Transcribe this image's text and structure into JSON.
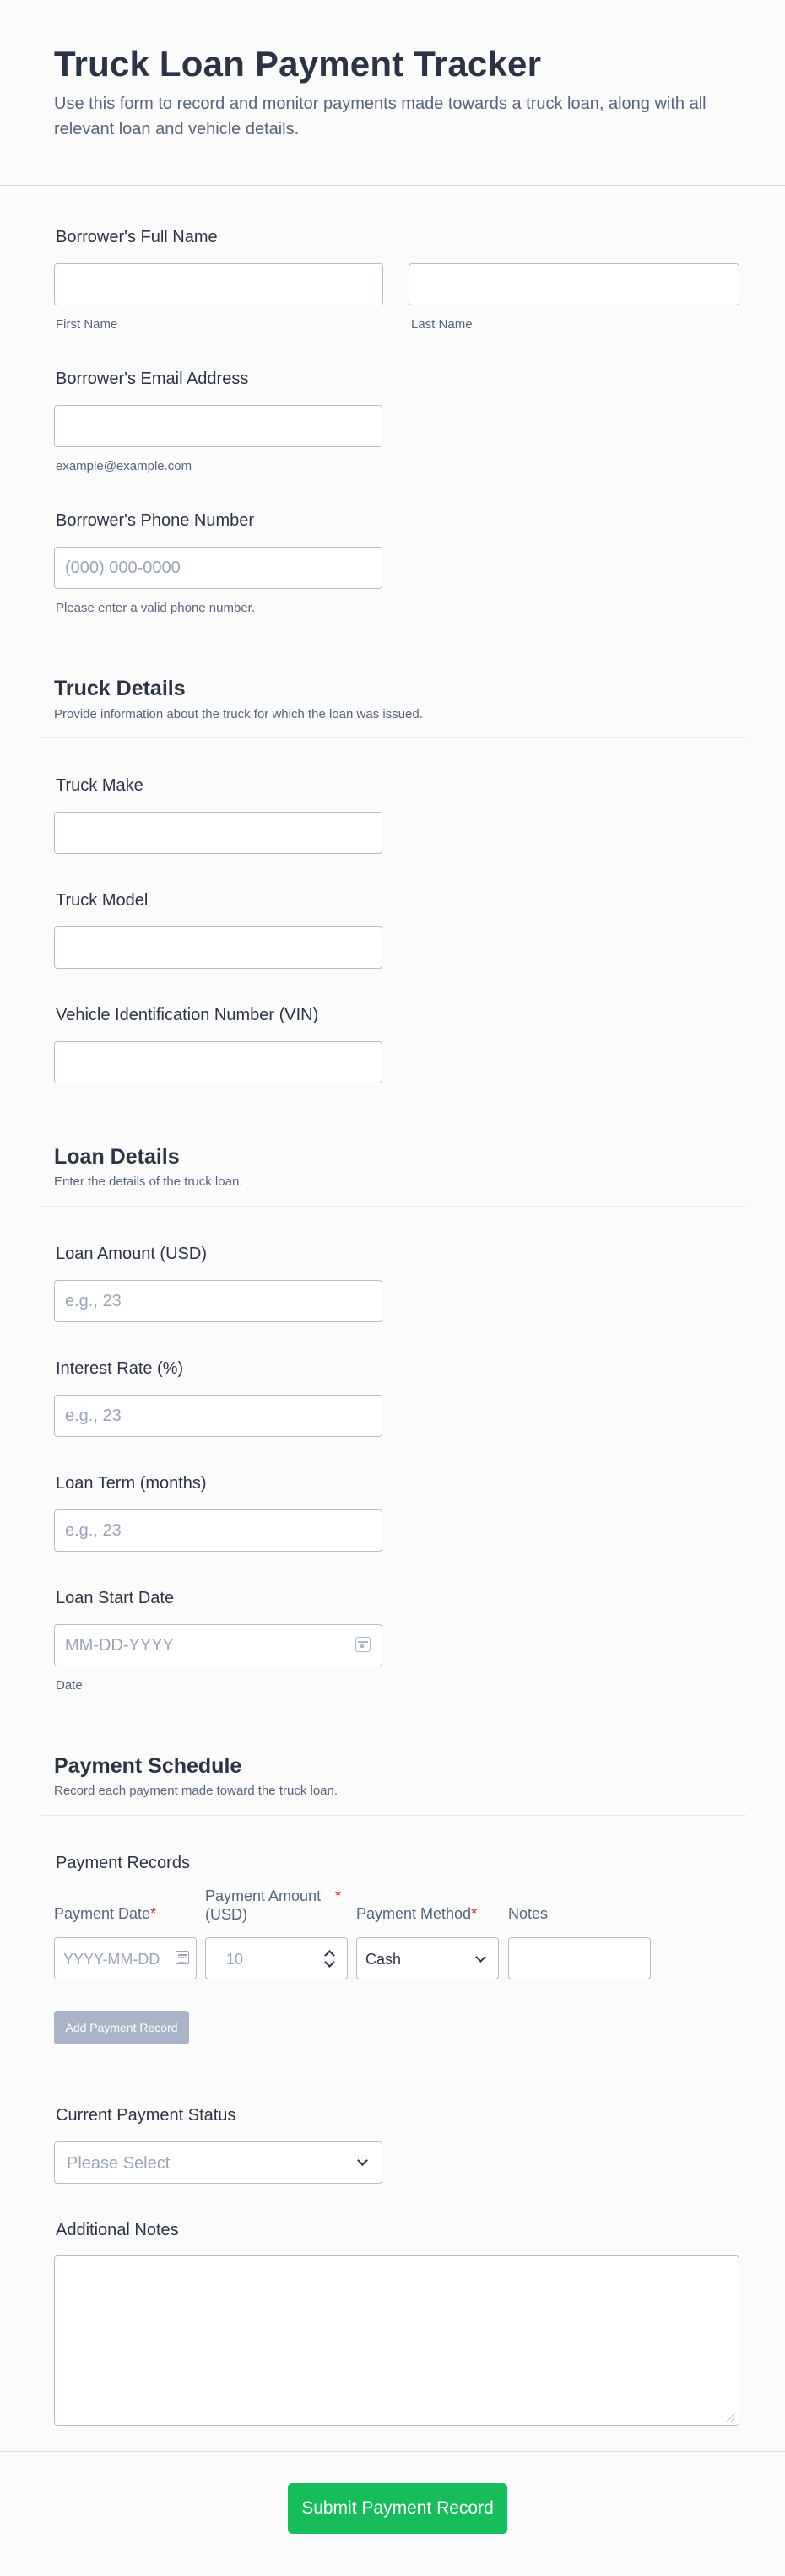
{
  "form": {
    "title": "Truck Loan Payment Tracker",
    "description": "Use this form to record and monitor payments made towards a truck loan, along with all relevant loan and vehicle details."
  },
  "borrower": {
    "name_label": "Borrower's Full Name",
    "first_sublabel": "First Name",
    "last_sublabel": "Last Name",
    "email_label": "Borrower's Email Address",
    "email_sublabel": "example@example.com",
    "phone_label": "Borrower's Phone Number",
    "phone_placeholder": "(000) 000-0000",
    "phone_sublabel": "Please enter a valid phone number."
  },
  "truck": {
    "title": "Truck Details",
    "subtitle": "Provide information about the truck for which the loan was issued.",
    "make_label": "Truck Make",
    "model_label": "Truck Model",
    "vin_label": "Vehicle Identification Number (VIN)"
  },
  "loan": {
    "title": "Loan Details",
    "subtitle": "Enter the details of the truck loan.",
    "amount_label": "Loan Amount (USD)",
    "amount_placeholder": "e.g., 23",
    "rate_label": "Interest Rate (%)",
    "rate_placeholder": "e.g., 23",
    "term_label": "Loan Term (months)",
    "term_placeholder": "e.g., 23",
    "start_label": "Loan Start Date",
    "start_placeholder": "MM-DD-YYYY",
    "start_sublabel": "Date"
  },
  "schedule": {
    "title": "Payment Schedule",
    "subtitle": "Record each payment made toward the truck loan.",
    "records_label": "Payment Records",
    "col_date": "Payment Date",
    "col_amount": "Payment Amount (USD)",
    "col_method": "Payment Method",
    "col_notes": "Notes",
    "required_mark": "*",
    "date_placeholder": "YYYY-MM-DD",
    "amount_placeholder": "10",
    "method_value": "Cash",
    "add_button": "Add Payment Record"
  },
  "status": {
    "label": "Current Payment Status",
    "placeholder": "Please Select"
  },
  "notes": {
    "label": "Additional Notes"
  },
  "submit_label": "Submit Payment Record"
}
